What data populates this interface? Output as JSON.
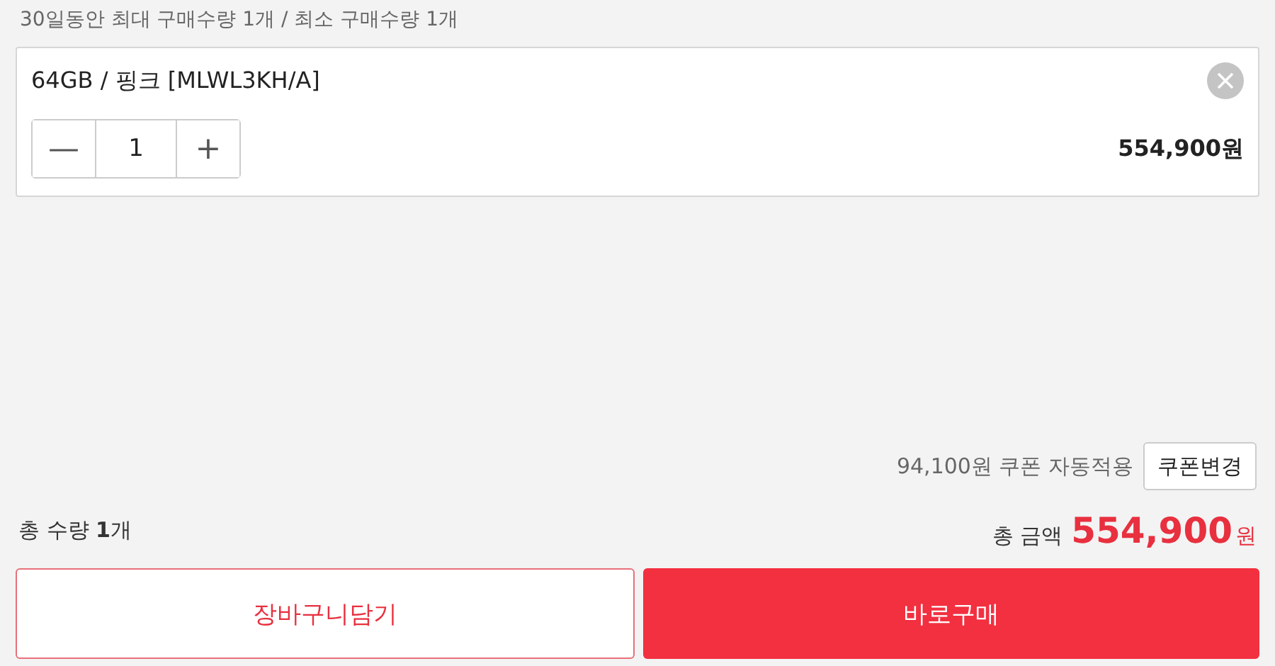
{
  "limit_note": "30일동안 최대 구매수량 1개 / 최소 구매수량 1개",
  "option": {
    "name": "64GB / 핑크 [MLWL3KH/A]",
    "minus": "—",
    "quantity": "1",
    "plus": "+",
    "price": "554,900원"
  },
  "coupon": {
    "note": "94,100원 쿠폰 자동적용",
    "button": "쿠폰변경"
  },
  "total_quantity": "총 수량 **1**개",
  "total": {
    "label": "총 금액",
    "amount": "554,900",
    "unit": "원"
  },
  "buttons": [
    {
      "label": "장바구니담기",
      "kind": "outline"
    },
    {
      "label": "바로구매",
      "kind": "filled"
    }
  ]
}
